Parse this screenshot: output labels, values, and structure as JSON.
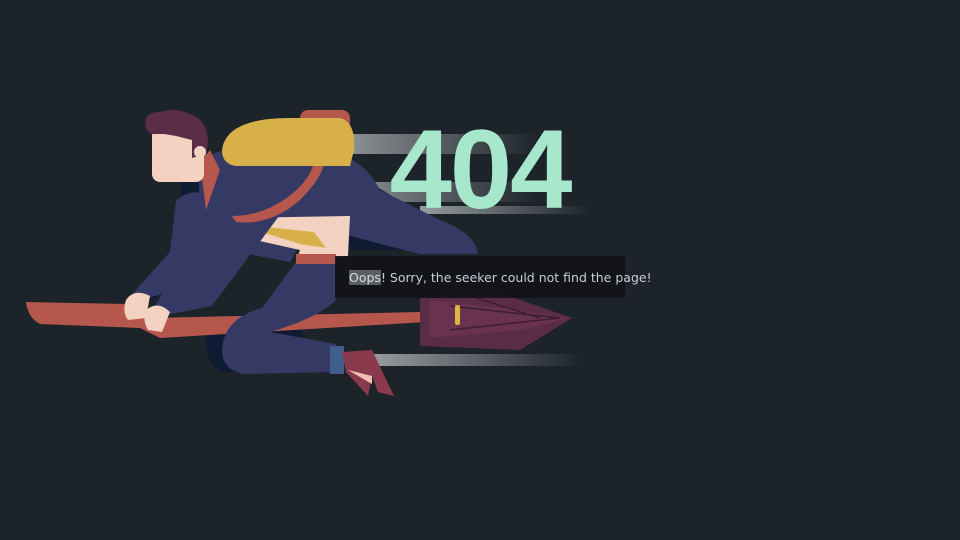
{
  "error": {
    "code": "404",
    "message_highlight": "Oops",
    "message_rest": "! Sorry, the seeker could not find the page!"
  },
  "colors": {
    "background": "#1c242a",
    "code": "#a7e8cd",
    "message_box": "#111418",
    "message_text": "#c9ced3"
  },
  "illustration": {
    "subject": "seeker-flying-on-broomstick"
  }
}
